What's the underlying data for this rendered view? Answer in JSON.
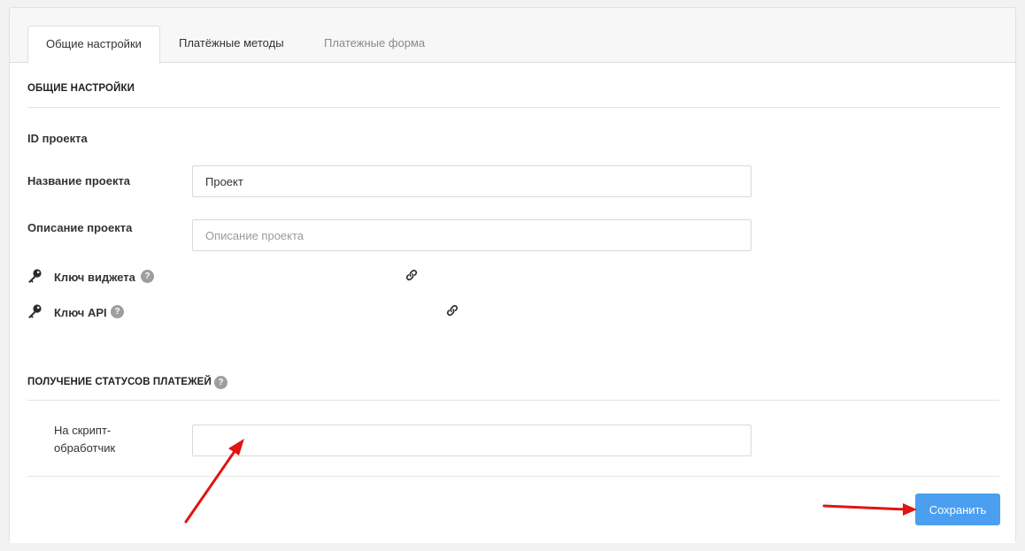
{
  "tabs": [
    {
      "label": "Общие настройки",
      "active": true
    },
    {
      "label": "Платёжные методы",
      "active": false
    },
    {
      "label": "Платежные форма",
      "active": false
    }
  ],
  "general": {
    "section_title": "ОБЩИЕ НАСТРОЙКИ",
    "project_id_label": "ID проекта",
    "project_name_label": "Название проекта",
    "project_name_value": "Проект",
    "project_description_label": "Описание проекта",
    "project_description_placeholder": "Описание проекта",
    "widget_key_label": "Ключ виджета",
    "api_key_label": "Ключ API"
  },
  "statuses": {
    "section_title": "ПОЛУЧЕНИЕ СТАТУСОВ ПЛАТЕЖЕЙ",
    "handler_label_line1": "На скрипт-",
    "handler_label_line2": "обработчик",
    "handler_value": ""
  },
  "actions": {
    "save_label": "Сохранить"
  },
  "icons": {
    "help": "question-circle-icon",
    "key": "key-icon",
    "link": "link-icon"
  },
  "colors": {
    "accent": "#4a9ff0",
    "annotation_arrow": "#e01414",
    "help_icon": "#9e9e9e"
  }
}
